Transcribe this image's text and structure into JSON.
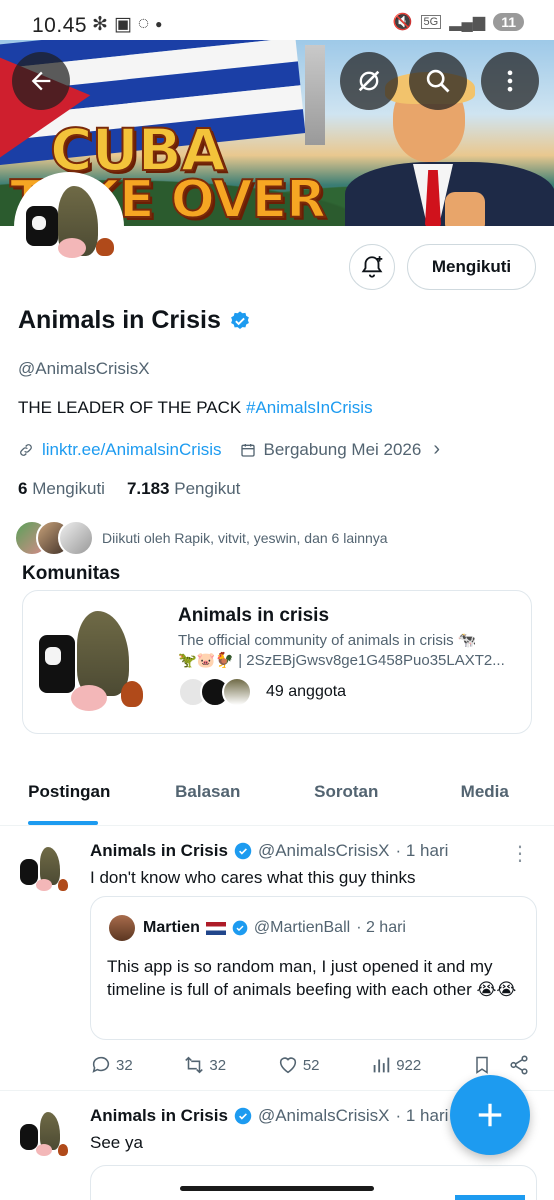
{
  "status_bar": {
    "time": "10.45",
    "network": "5G",
    "battery": "11"
  },
  "banner": {
    "line1": "CUBA",
    "line2": "TAKE OVER"
  },
  "profile": {
    "follow_button": "Mengikuti",
    "name": "Animals in Crisis",
    "handle": "@AnimalsCrisisX",
    "bio_text": "THE LEADER OF THE PACK ",
    "bio_hashtag": "#AnimalsInCrisis",
    "link": "linktr.ee/AnimalsinCrisis",
    "joined": "Bergabung Mei 2026",
    "following_count": "6",
    "following_label": "Mengikuti",
    "followers_count": "7.183",
    "followers_label": "Pengikut",
    "followed_by": "Diikuti oleh Rapik, vitvit, yeswin, dan 6 lainnya"
  },
  "community": {
    "section_title": "Komunitas",
    "name": "Animals in crisis",
    "desc_line1": "The official community of animals in crisis 🐄",
    "desc_line2": "🦖🐷🐓 | 2SzEBjGwsv8ge1G458Puo35LAXT2...",
    "members": "49 anggota"
  },
  "tabs": [
    "Postingan",
    "Balasan",
    "Sorotan",
    "Media"
  ],
  "posts": [
    {
      "name": "Animals in Crisis",
      "handle": "@AnimalsCrisisX",
      "time": "· 1 hari",
      "text": "I don't know who cares what this guy thinks",
      "quote": {
        "name": "Martien",
        "handle": "@MartienBall",
        "time": "· 2 hari",
        "text": "This app is so random man, I just opened it and my timeline is full of animals beefing with each other 😭😭"
      },
      "replies": "32",
      "reposts": "32",
      "likes": "52",
      "views": "922"
    },
    {
      "name": "Animals in Crisis",
      "handle": "@AnimalsCrisisX",
      "time": "· 1 hari",
      "text": "See ya"
    }
  ],
  "icons": {
    "back": "back-arrow-icon",
    "grok": "grok-icon",
    "search": "search-icon",
    "more": "more-vertical-icon",
    "bell": "bell-plus-icon",
    "verified": "verified-badge-icon",
    "link": "link-icon",
    "calendar": "calendar-icon",
    "compose": "plus-icon"
  },
  "colors": {
    "accent": "#1d9bf0",
    "text": "#0f1419",
    "secondary": "#536471"
  }
}
